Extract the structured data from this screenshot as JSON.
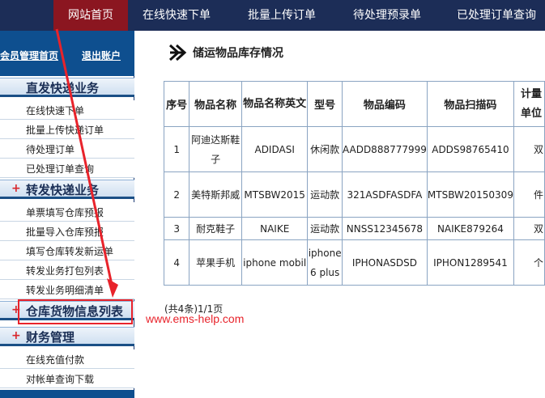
{
  "topnav": {
    "items": [
      "网站首页",
      "在线快速下单",
      "批量上传订单",
      "待处理预录单",
      "已处理订单查询"
    ]
  },
  "sidebar": {
    "top_links": [
      "会员管理首页",
      "退出账户"
    ],
    "sections": [
      {
        "title": "直发快递业务",
        "items": [
          "在线快速下单",
          "批量上传快递订单",
          "待处理订单",
          "已处理订单查询"
        ]
      },
      {
        "title": "转发快递业务",
        "items": [
          "单票填写仓库预报",
          "批量导入仓库预报",
          "填写仓库转发新运单",
          "转发业务打包列表",
          "转发业务明细清单"
        ]
      },
      {
        "title": "仓库货物信息列表",
        "items": []
      },
      {
        "title": "财务管理",
        "items": [
          "在线充值付款",
          "对帐单查询下载"
        ]
      }
    ]
  },
  "main": {
    "title": "储运物品库存情况",
    "columns": [
      "序号",
      "物品名称",
      "物品名称英文",
      "型号",
      "物品编码",
      "物品扫描码",
      "计量单位"
    ],
    "rows": [
      [
        "1",
        "阿迪达斯鞋子",
        "ADIDASI",
        "休闲款",
        "AADD888777999",
        "ADDS98765410",
        "双"
      ],
      [
        "2",
        "美特斯邦威",
        "MTSBW2015",
        "运动款",
        "321ASDFASDFA",
        "MTSBW20150309",
        "件"
      ],
      [
        "3",
        "耐克鞋子",
        "NAIKE",
        "运动款",
        "NNSS12345678",
        "NAIKE879264",
        "双"
      ],
      [
        "4",
        "苹果手机",
        "iphone mobil",
        "iphone 6 plus",
        "IPHONASDSD",
        "IPHON1289541",
        "个"
      ]
    ],
    "pager": "(共4条)1/1页"
  },
  "watermark": "www.ems-help.com",
  "colors": {
    "nav_bg": "#1c2d57",
    "nav_active": "#8b1620",
    "sidebar_blue": "#0e4f8f",
    "annotation_red": "#e8232b"
  }
}
